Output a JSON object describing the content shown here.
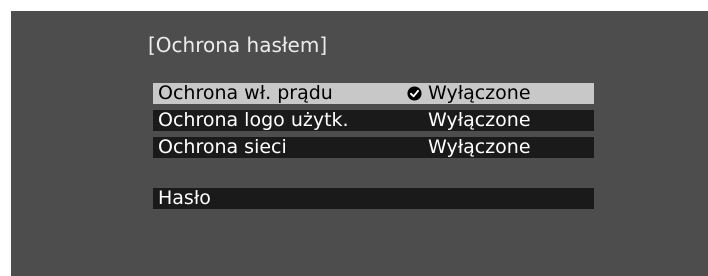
{
  "menu": {
    "title": "[Ochrona hasłem]",
    "items": [
      {
        "label": "Ochrona wł. prądu",
        "value": "Wyłączone",
        "selected": true
      },
      {
        "label": "Ochrona logo użytk.",
        "value": "Wyłączone",
        "selected": false
      },
      {
        "label": "Ochrona sieci",
        "value": "Wyłączone",
        "selected": false
      }
    ],
    "password_item": {
      "label": "Hasło"
    }
  },
  "icons": {
    "selected_value_marker": "check-circle-icon"
  },
  "colors": {
    "background": "#4d4d4d",
    "row_background": "#1a1a1a",
    "selected_row_background": "#c8c8c8"
  }
}
